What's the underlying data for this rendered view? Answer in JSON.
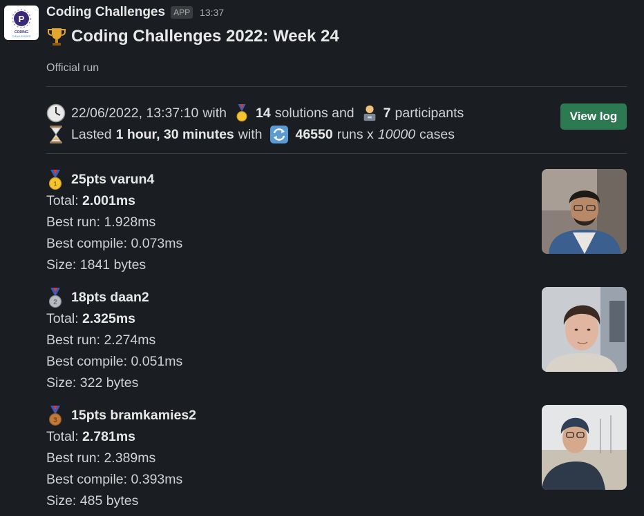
{
  "message": {
    "sender": "Coding Challenges",
    "badge": "APP",
    "time": "13:37",
    "avatar_icon": "coding-challenges-logo",
    "avatar_text": "CODING CHALLENGES",
    "title": "Coding Challenges 2022: Week 24",
    "title_icon": "trophy-icon",
    "subtitle": "Official run"
  },
  "summary": {
    "datetime": "22/06/2022, 13:37:10",
    "with1": "with",
    "solutions_count": "14",
    "solutions_label": "solutions and",
    "participants_count": "7",
    "participants_label": "participants",
    "lasted_label": "Lasted",
    "duration": "1 hour, 30 minutes",
    "with2": "with",
    "runs": "46550",
    "runs_label": "runs x",
    "cases": "10000",
    "cases_label": "cases",
    "view_log_label": "View log"
  },
  "results": [
    {
      "medal": "gold-medal-icon",
      "heading": "25pts varun4",
      "total_label": "Total:",
      "total": "2.001ms",
      "best_run": "Best run: 1.928ms",
      "best_compile": "Best compile: 0.073ms",
      "size": "Size: 1841 bytes"
    },
    {
      "medal": "silver-medal-icon",
      "heading": "18pts daan2",
      "total_label": "Total:",
      "total": "2.325ms",
      "best_run": "Best run: 2.274ms",
      "best_compile": "Best compile: 0.051ms",
      "size": "Size: 322 bytes"
    },
    {
      "medal": "bronze-medal-icon",
      "heading": "15pts bramkamies2",
      "total_label": "Total:",
      "total": "2.781ms",
      "best_run": "Best run: 2.389ms",
      "best_compile": "Best compile: 0.393ms",
      "size": "Size: 485 bytes"
    }
  ],
  "colors": {
    "background": "#1a1d21",
    "button": "#2d7a52",
    "gold": "#f4c430",
    "silver": "#b8bcc2",
    "bronze": "#c07a3e"
  }
}
